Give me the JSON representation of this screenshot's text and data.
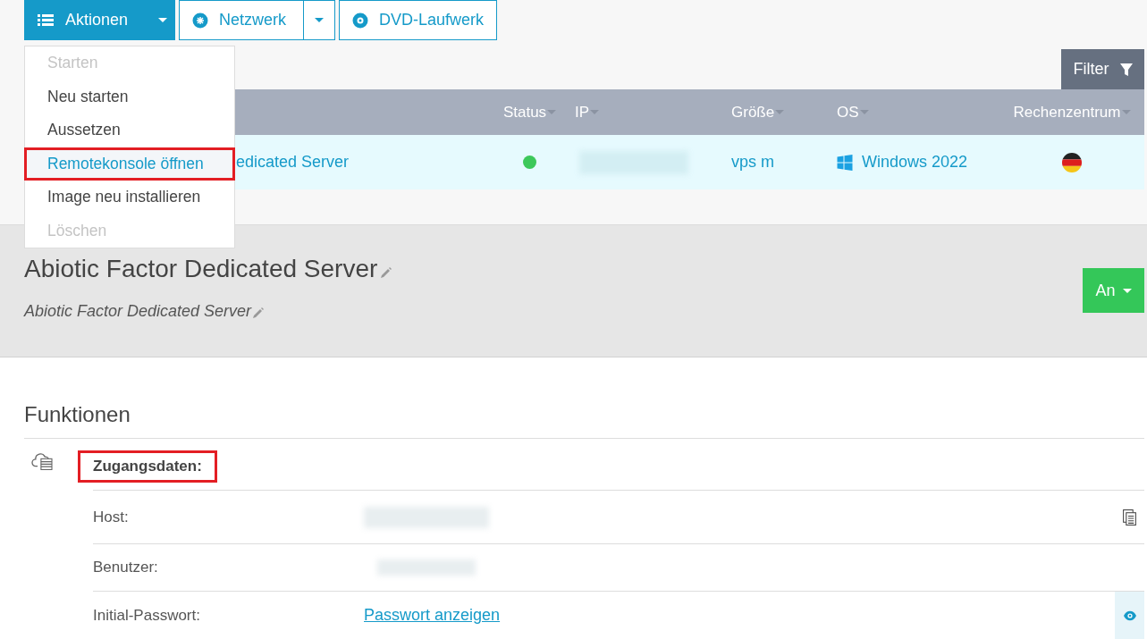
{
  "toolbar": {
    "buttons": [
      {
        "label": "Aktionen",
        "kind": "primary",
        "split": true
      },
      {
        "label": "Netzwerk",
        "kind": "network",
        "split": true
      },
      {
        "label": "DVD-Laufwerk",
        "kind": "disc",
        "split": false
      }
    ]
  },
  "actions_menu": {
    "items": [
      {
        "label": "Starten",
        "disabled": true,
        "highlighted": false
      },
      {
        "label": "Neu starten",
        "disabled": false,
        "highlighted": false
      },
      {
        "label": "Aussetzen",
        "disabled": false,
        "highlighted": false
      },
      {
        "label": "Remotekonsole öffnen",
        "disabled": false,
        "highlighted": true
      },
      {
        "label": "Image neu installieren",
        "disabled": false,
        "highlighted": false
      },
      {
        "label": "Löschen",
        "disabled": true,
        "highlighted": false
      }
    ]
  },
  "filter_button": {
    "label": "Filter"
  },
  "table": {
    "columns": [
      "Status",
      "IP",
      "Größe",
      "OS",
      "Rechenzentrum"
    ],
    "rows": [
      {
        "name": "edicated Server",
        "color": "#3cc85a",
        "size": "vps m",
        "os": "Windows 2022"
      }
    ]
  },
  "server": {
    "title": "Abiotic Factor Dedicated Server",
    "description": "Abiotic Factor Dedicated Server",
    "power_button": {
      "label": "An"
    }
  },
  "functions": {
    "heading": "Funktionen",
    "sections": [
      {
        "title": "Zugangsdaten:",
        "highlighted": true,
        "fields": [
          {
            "label": "Host:",
            "kind": "copy"
          },
          {
            "label": "Benutzer:",
            "kind": "plain"
          },
          {
            "label": "Initial-Passwort:",
            "kind": "reveal",
            "link": "Passwort anzeigen"
          }
        ]
      }
    ]
  }
}
